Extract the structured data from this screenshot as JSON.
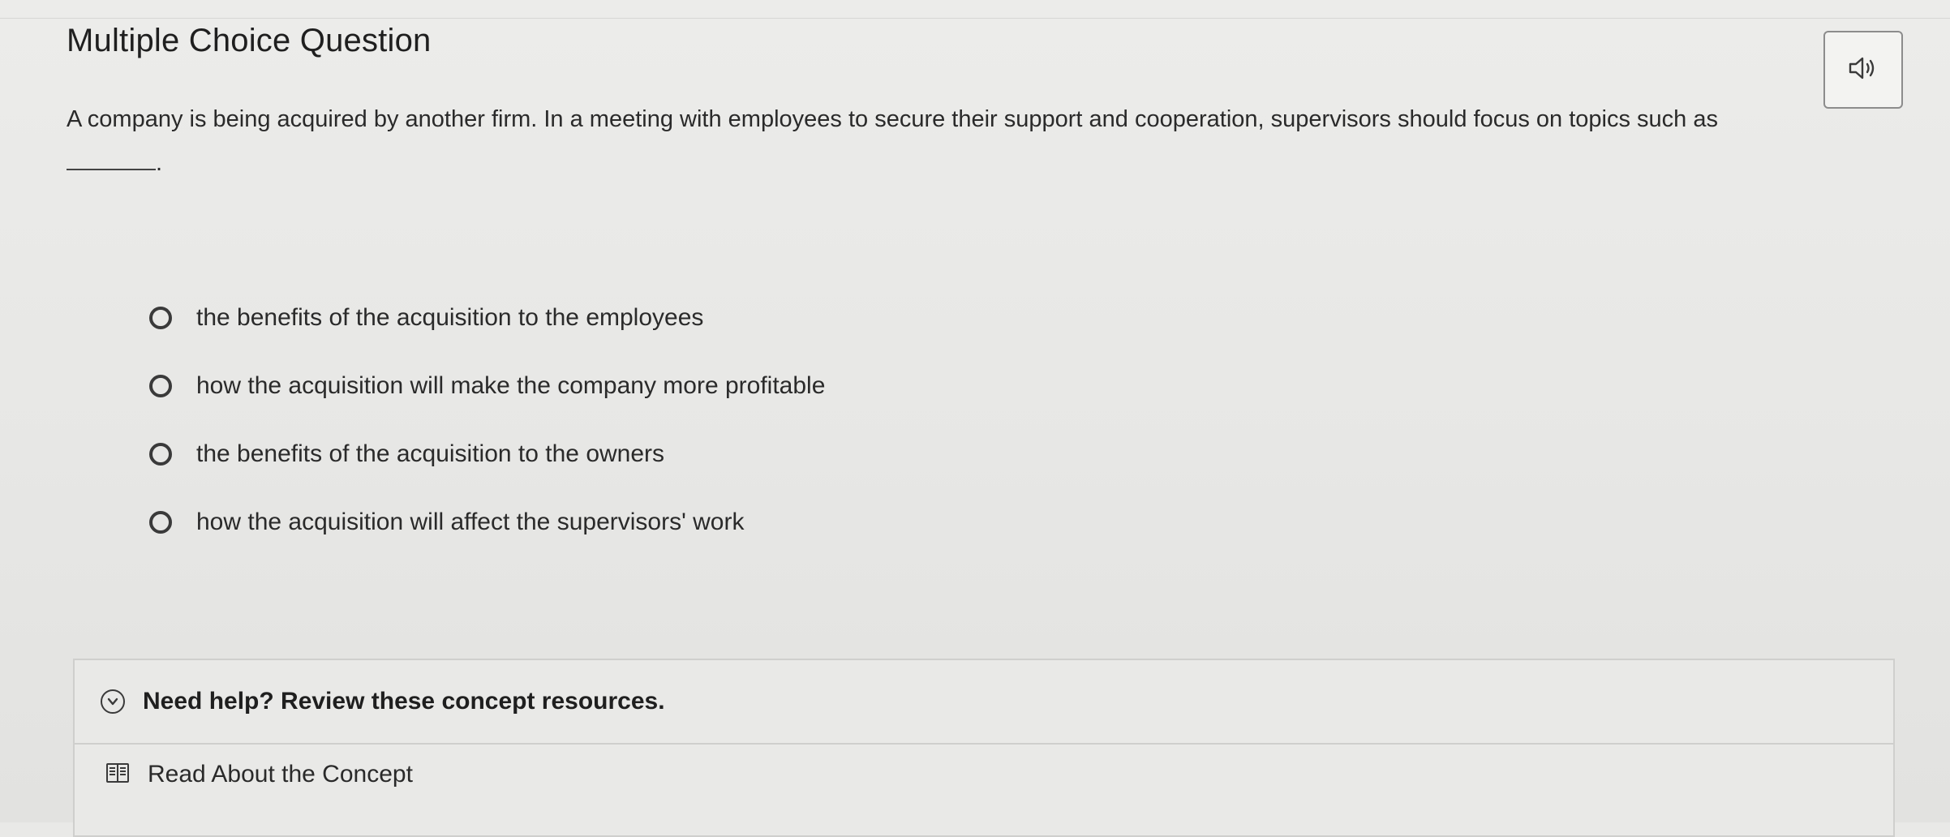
{
  "header": {
    "title": "Multiple Choice Question",
    "audio_icon": "speaker-icon"
  },
  "question": {
    "text": "A company is being acquired by another firm. In a meeting with employees to secure their support and cooperation, supervisors should focus on topics such as",
    "end_punct": "."
  },
  "options": [
    {
      "label": "the benefits of the acquisition to the employees"
    },
    {
      "label": "how the acquisition will make the company more profitable"
    },
    {
      "label": "the benefits of the acquisition to the owners"
    },
    {
      "label": "how the acquisition will affect the supervisors' work"
    }
  ],
  "help": {
    "title": "Need help? Review these concept resources.",
    "chevron_icon": "chevron-down-icon",
    "resource_label": "Read About the Concept",
    "resource_icon": "book-icon"
  }
}
